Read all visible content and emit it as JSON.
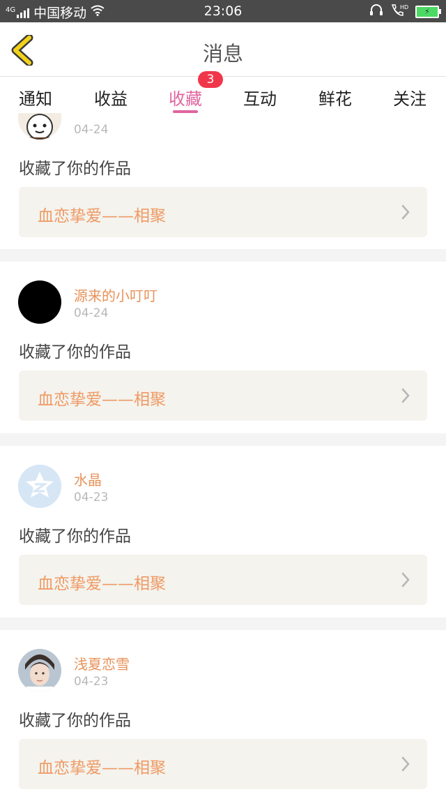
{
  "status_bar": {
    "network": "4G",
    "carrier": "中国移动",
    "time": "23:06",
    "hd": "HD"
  },
  "header": {
    "title": "消息"
  },
  "tabs": [
    {
      "label": "通知"
    },
    {
      "label": "收益"
    },
    {
      "label": "收藏",
      "badge": "3",
      "active": true
    },
    {
      "label": "互动"
    },
    {
      "label": "鲜花"
    },
    {
      "label": "关注"
    }
  ],
  "feed": [
    {
      "username": "",
      "date": "04-24",
      "action": "收藏了你的作品",
      "work_title": "血恋挚爱——相聚"
    },
    {
      "username": "源来的小叮叮",
      "date": "04-24",
      "action": "收藏了你的作品",
      "work_title": "血恋挚爱——相聚"
    },
    {
      "username": "水晶",
      "date": "04-23",
      "action": "收藏了你的作品",
      "work_title": "血恋挚爱——相聚"
    },
    {
      "username": "浅夏恋雪",
      "date": "04-23",
      "action": "收藏了你的作品",
      "work_title": "血恋挚爱——相聚"
    }
  ],
  "colors": {
    "accent": "#e0659f",
    "badge": "#f0374a",
    "username": "#e8925a",
    "work_title": "#ef9a64",
    "work_box": "#f4f3ee",
    "back_arrow": "#f2d21a"
  }
}
